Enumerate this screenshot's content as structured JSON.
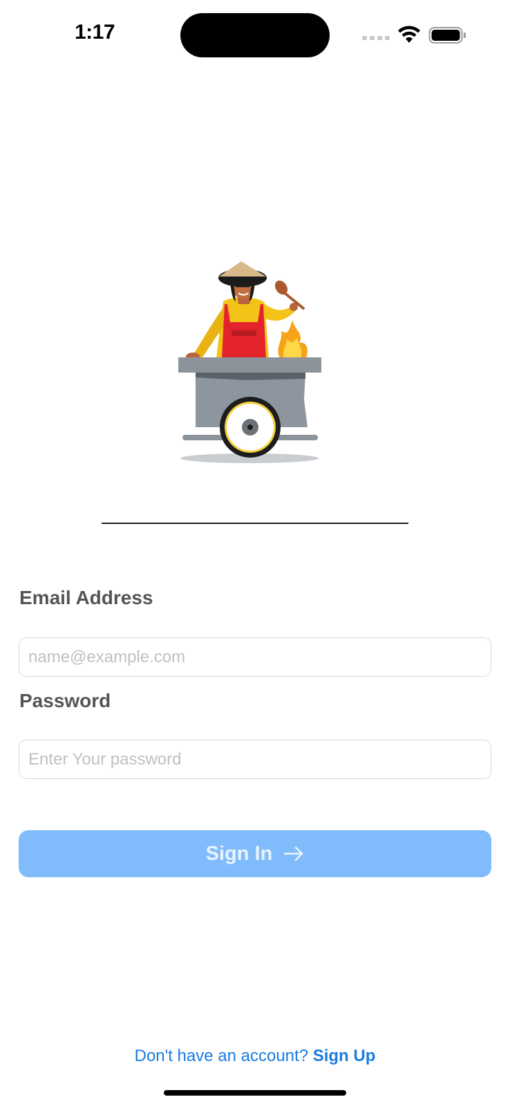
{
  "status_bar": {
    "time": "1:17"
  },
  "form": {
    "email_label": "Email Address",
    "email_placeholder": "name@example.com",
    "email_value": "",
    "password_label": "Password",
    "password_placeholder": "Enter Your password",
    "password_value": ""
  },
  "actions": {
    "sign_in_label": "Sign In",
    "sign_in_icon": "arrow-right-icon",
    "sign_in_color": "#80bcfb"
  },
  "footer": {
    "prompt": "Don't have an account?",
    "sign_up_label": "Sign Up",
    "link_color": "#1a7cdf"
  },
  "illustration": {
    "subject": "street-food-vendor-cart-illustration"
  }
}
